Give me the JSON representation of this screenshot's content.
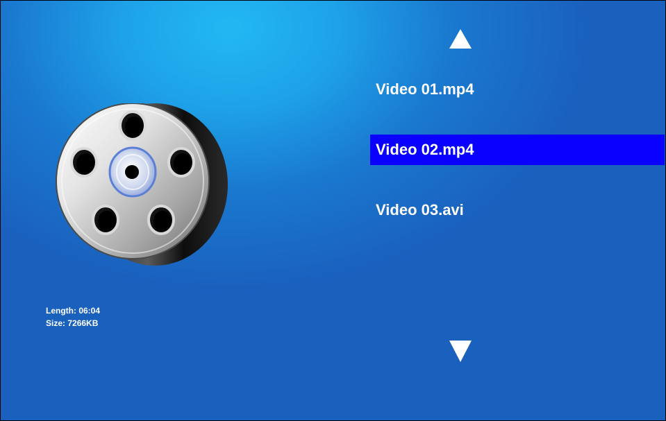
{
  "colors": {
    "selection_highlight": "#0a00ff",
    "text": "#ffffff"
  },
  "icons": {
    "film": "film-reel-icon",
    "scroll_up": "triangle-up-icon",
    "scroll_down": "triangle-down-icon"
  },
  "file_info": {
    "length_text": "Length: 06:04",
    "size_text": "Size: 7266KB"
  },
  "playlist": {
    "selected_index": 1,
    "items": [
      {
        "label": "Video 01.mp4"
      },
      {
        "label": "Video 02.mp4"
      },
      {
        "label": "Video 03.avi"
      }
    ]
  }
}
